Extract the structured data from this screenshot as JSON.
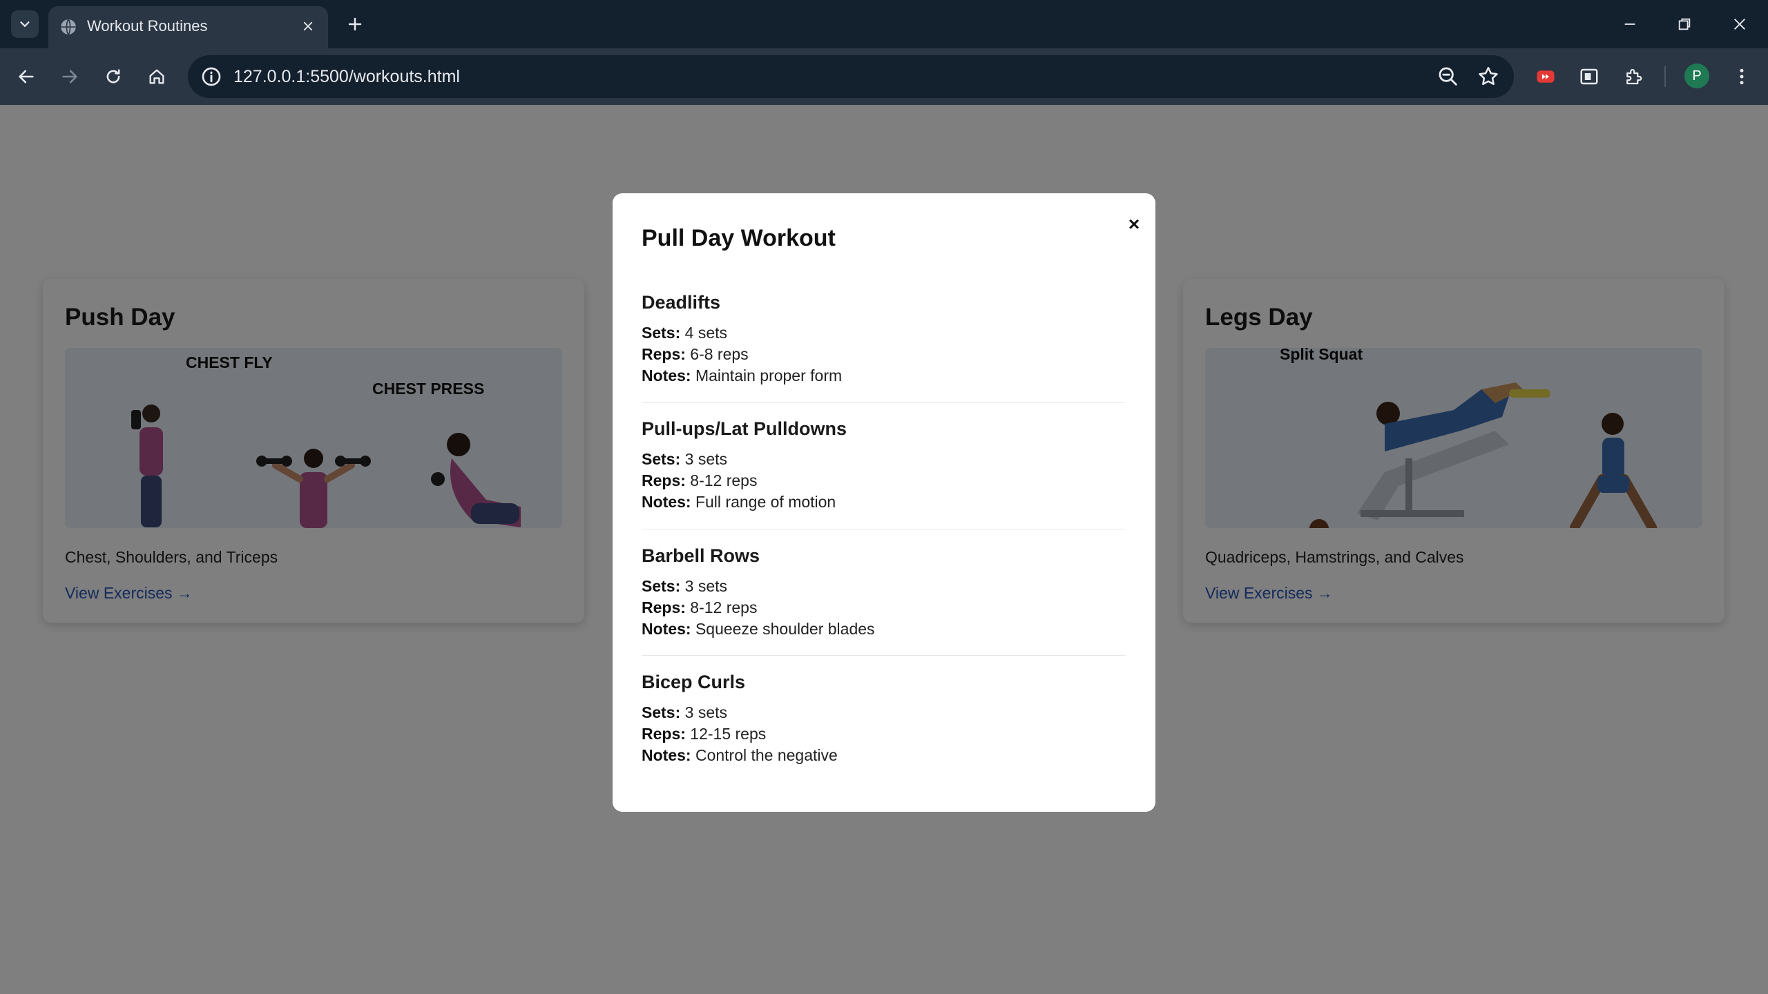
{
  "browser": {
    "tab_title": "Workout Routines",
    "url": "127.0.0.1:5500/workouts.html",
    "profile_initial": "P"
  },
  "cards": [
    {
      "title": "Push Day",
      "image_labels": [
        "CHEST FLY",
        "CHEST PRESS"
      ],
      "description": "Chest, Shoulders, and Triceps",
      "link": "View Exercises →"
    },
    {
      "title": "Legs Day",
      "image_labels": [
        "Split Squat"
      ],
      "description": "Quadriceps, Hamstrings, and Calves",
      "link": "View Exercises →"
    }
  ],
  "modal": {
    "title": "Pull Day Workout",
    "close": "×",
    "labels": {
      "sets": "Sets:",
      "reps": "Reps:",
      "notes": "Notes:"
    },
    "exercises": [
      {
        "name": "Deadlifts",
        "sets": "4 sets",
        "reps": "6-8 reps",
        "notes": "Maintain proper form"
      },
      {
        "name": "Pull-ups/Lat Pulldowns",
        "sets": "3 sets",
        "reps": "8-12 reps",
        "notes": "Full range of motion"
      },
      {
        "name": "Barbell Rows",
        "sets": "3 sets",
        "reps": "8-12 reps",
        "notes": "Squeeze shoulder blades"
      },
      {
        "name": "Bicep Curls",
        "sets": "3 sets",
        "reps": "12-15 reps",
        "notes": "Control the negative"
      }
    ]
  }
}
